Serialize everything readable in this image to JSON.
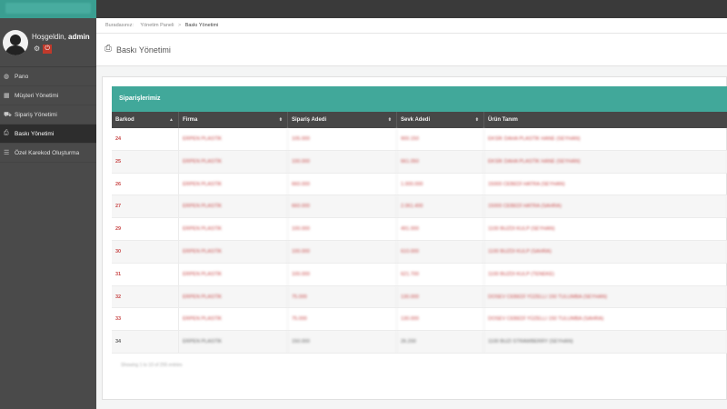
{
  "topbar": {
    "brand_color": "#3a9e91"
  },
  "sidebar": {
    "welcome_prefix": "Hoşgeldin,",
    "username": "admin",
    "items": [
      {
        "label": "Pano",
        "icon": "dashboard-icon"
      },
      {
        "label": "Müşteri Yönetimi",
        "icon": "table-icon"
      },
      {
        "label": "Sipariş Yönetimi",
        "icon": "cart-icon"
      },
      {
        "label": "Baskı Yönetimi",
        "icon": "printer-icon",
        "active": true
      },
      {
        "label": "Özel Karekod Oluşturma",
        "icon": "list-icon"
      }
    ]
  },
  "breadcrumb": {
    "prefix": "Buradasınız:",
    "item1": "Yönetim Paneli",
    "item2": "Baskı Yönetimi"
  },
  "page": {
    "title": "Baskı Yönetimi"
  },
  "panel": {
    "title": "Siparişlerimiz",
    "columns": [
      "Barkod",
      "Firma",
      "Sipariş Adedi",
      "Sevk Adedi",
      "Ürün Tanım"
    ],
    "rows": [
      {
        "barkod": "24",
        "firma": "ERPEN PLASTİK",
        "siparis": "105.000",
        "sevk": "900.150",
        "urun": "EKSİK DAHA PLASTİK HANE (SEYHAN)"
      },
      {
        "barkod": "25",
        "firma": "ERPEN PLASTİK",
        "siparis": "100.000",
        "sevk": "661.050",
        "urun": "EKSİK DAHA PLASTİK HANE (SEYHAN)"
      },
      {
        "barkod": "26",
        "firma": "ERPEN PLASTİK",
        "siparis": "660.000",
        "sevk": "1.000.000",
        "urun": "15000 CEBEDİ HATRA (SEYHAN)"
      },
      {
        "barkod": "27",
        "firma": "ERPEN PLASTİK",
        "siparis": "660.000",
        "sevk": "2.061.400",
        "urun": "15000 CEBEDİ HATRA (SAHRA)"
      },
      {
        "barkod": "29",
        "firma": "ERPEN PLASTİK",
        "siparis": "100.000",
        "sevk": "491.000",
        "urun": "1100 BUZDI KULP (SEYHAN)"
      },
      {
        "barkod": "30",
        "firma": "ERPEN PLASTİK",
        "siparis": "100.000",
        "sevk": "610.000",
        "urun": "1100 BUZDI KULP (SAHRA)"
      },
      {
        "barkod": "31",
        "firma": "ERPEN PLASTİK",
        "siparis": "100.000",
        "sevk": "621.700",
        "urun": "1100 BUZDI KULP (TENEKE)"
      },
      {
        "barkod": "32",
        "firma": "ERPEN PLASTİK",
        "siparis": "75.000",
        "sevk": "130.000",
        "urun": "DOSEV CEBEDİ YÜZELLI 150 TULUMBA (SEYHAN)"
      },
      {
        "barkod": "33",
        "firma": "ERPEN PLASTİK",
        "siparis": "75.000",
        "sevk": "130.000",
        "urun": "DOSEV CEBEDİ YÜZELLI 150 TULUMBA (SAHRA)"
      },
      {
        "barkod": "34",
        "firma": "ERPEN PLASTİK",
        "siparis": "150.000",
        "sevk": "26.200",
        "urun": "1100 BUZI STRAWBERRY (SEYHAN)"
      }
    ],
    "showing": "Showing 1 to 10 of 255 entries"
  }
}
